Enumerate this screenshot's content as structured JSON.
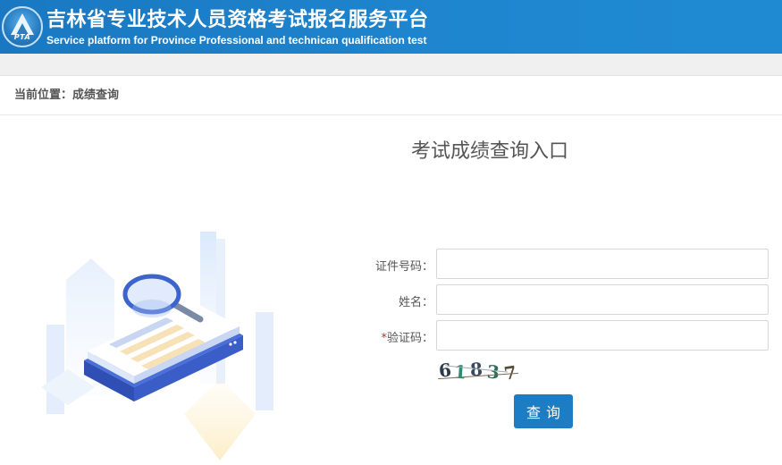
{
  "header": {
    "logo_text": "PTA",
    "title_cn": "吉林省专业技术人员资格考试报名服务平台",
    "title_en": "Service platform for Province Professional and technican qualification test"
  },
  "breadcrumb": {
    "text": "当前位置：成绩查询"
  },
  "form": {
    "title": "考试成绩查询入口",
    "id_label": "证件号码：",
    "name_label": "姓名：",
    "captcha_required_mark": "*",
    "captcha_label": "验证码：",
    "id_value": "",
    "name_value": "",
    "captcha_value": "",
    "captcha_image_text": [
      "6",
      "1",
      "8",
      "3",
      "7"
    ],
    "submit_label": "查询"
  },
  "colors": {
    "header_bg": "#1e86cf",
    "button_bg": "#1c7cc4",
    "required_mark": "#d9232d"
  }
}
